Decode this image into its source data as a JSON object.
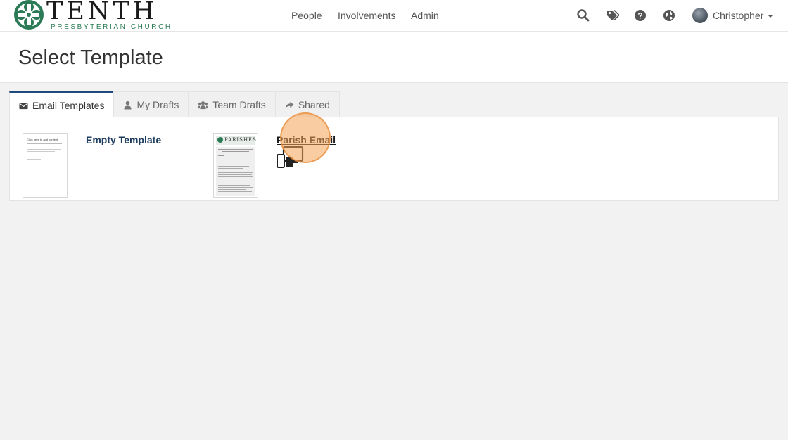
{
  "brand": {
    "name": "TENTH",
    "subtitle": "PRESBYTERIAN CHURCH"
  },
  "nav": {
    "links": [
      {
        "label": "People"
      },
      {
        "label": "Involvements"
      },
      {
        "label": "Admin"
      }
    ],
    "icons": [
      "search-icon",
      "tag-icon",
      "help-icon",
      "globe-icon"
    ],
    "user": {
      "name": "Christopher"
    }
  },
  "page": {
    "title": "Select Template"
  },
  "tabs": [
    {
      "label": "Email Templates",
      "icon": "envelope-icon",
      "active": true
    },
    {
      "label": "My Drafts",
      "icon": "user-icon",
      "active": false
    },
    {
      "label": "Team Drafts",
      "icon": "users-icon",
      "active": false
    },
    {
      "label": "Shared",
      "icon": "share-icon",
      "active": false
    }
  ],
  "templates": [
    {
      "name": "Empty Template",
      "thumbnail_heading": "Click here to add content"
    },
    {
      "name": "Parish Email",
      "thumbnail_heading": "PARISHES",
      "badge_icon": "responsive-devices-icon"
    }
  ],
  "colors": {
    "brand_green": "#2a7a55",
    "tab_active_border": "#1e4a7e",
    "template_link": "#1f3d5e",
    "click_highlight": "#f4a454"
  }
}
